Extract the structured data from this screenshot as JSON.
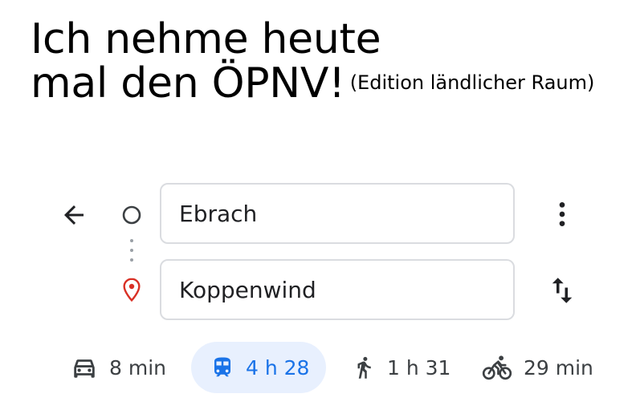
{
  "headline": {
    "line1": "Ich nehme heute",
    "line2": "mal den ÖPNV!",
    "subtitle": "(Edition ländlicher Raum)"
  },
  "directions": {
    "origin": {
      "value": "Ebrach",
      "icon": "origin-circle-icon"
    },
    "destination": {
      "value": "Koppenwind",
      "icon": "location-pin-icon",
      "icon_color": "#d93025"
    },
    "back_icon": "arrow-back-icon",
    "more_icon": "more-vert-icon",
    "swap_icon": "swap-vert-icon"
  },
  "travel_modes": [
    {
      "mode": "driving",
      "icon": "car-icon",
      "time": "8 min",
      "selected": false
    },
    {
      "mode": "transit",
      "icon": "train-icon",
      "time": "4 h 28",
      "selected": true,
      "color": "#1a73e8",
      "background": "#e8f0fe"
    },
    {
      "mode": "walking",
      "icon": "walk-icon",
      "time": "1 h 31",
      "selected": false
    },
    {
      "mode": "cycling",
      "icon": "bike-icon",
      "time": "29 min",
      "selected": false
    }
  ]
}
